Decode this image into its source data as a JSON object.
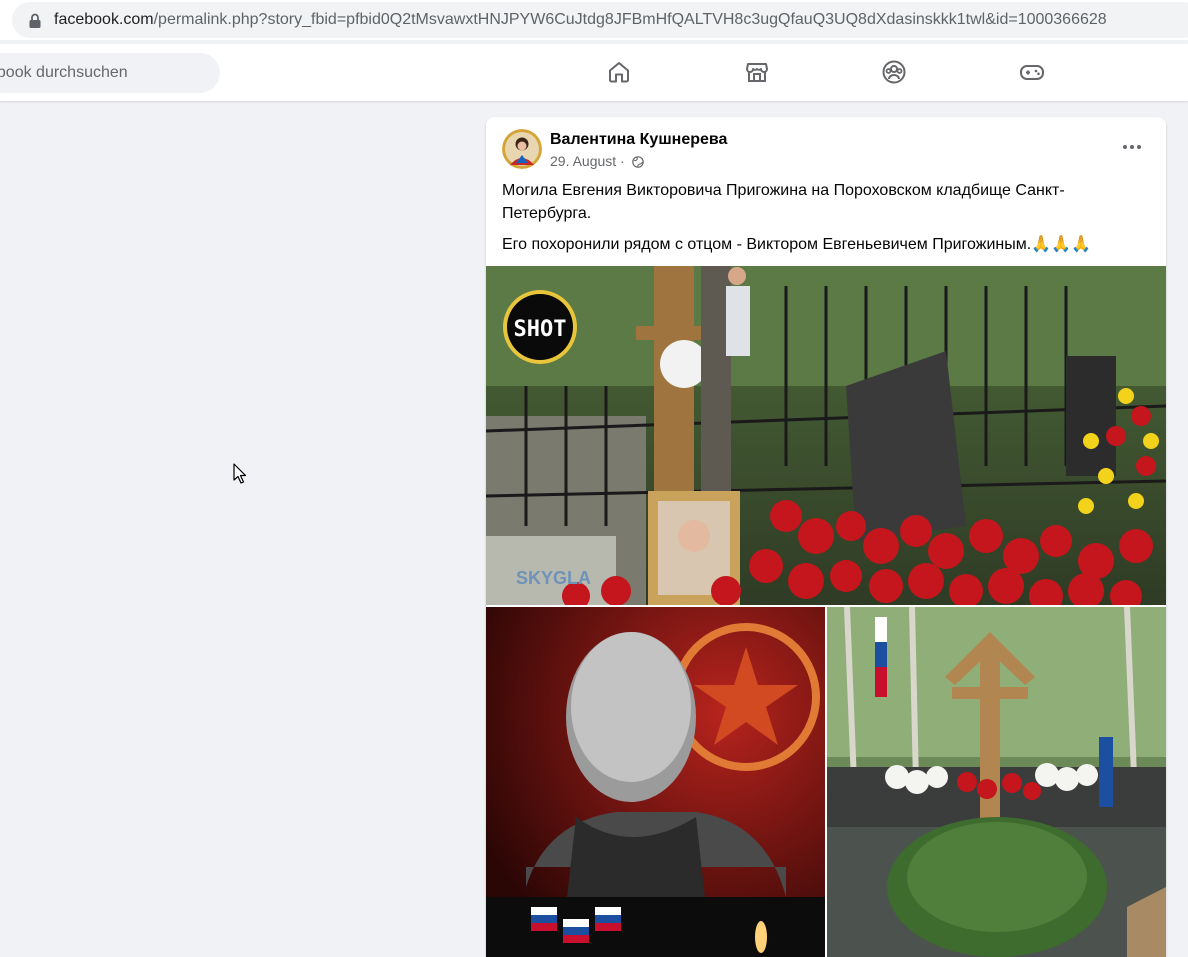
{
  "browser": {
    "url_host": "facebook.com",
    "url_path": "/permalink.php?story_fbid=pfbid0Q2tMsvawxtHNJPYW6CuJtdg8JFBmHfQALTVH8c3ugQfauQ3UQ8dXdasinskkk1twl&id=1000366628"
  },
  "nav": {
    "search_placeholder": "ebook durchsuchen",
    "icons": [
      "home-icon",
      "marketplace-icon",
      "groups-icon",
      "gaming-icon"
    ]
  },
  "post": {
    "author": "Валентина Кушнерева",
    "date": "29. August ·",
    "text_line1": "Могила Евгения Викторовича Пригожина на Пороховском кладбище Санкт-Петербурга.",
    "text_line2": "Его похоронили рядом с отцом - Виктором Евгеньевичем Пригожиным.🙏🙏🙏",
    "watermark": "SHOT",
    "sign_text": "SKYGLA"
  },
  "colors": {
    "page_bg": "#f0f2f5",
    "card_bg": "#ffffff",
    "secondary_text": "#65676b",
    "icon": "#65676b"
  }
}
